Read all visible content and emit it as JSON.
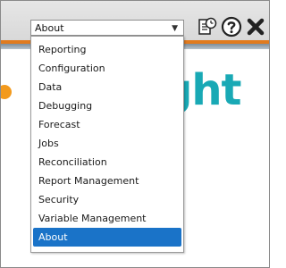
{
  "select": {
    "value": "About",
    "arrow_icon": "chevron-down-icon"
  },
  "toolbar": {
    "icons": [
      "report-schedule-icon",
      "help-icon",
      "close-icon"
    ]
  },
  "menu": {
    "options": [
      "Reporting",
      "Configuration",
      "Data",
      "Debugging",
      "Forecast",
      "Jobs",
      "Reconciliation",
      "Report Management",
      "Security",
      "Variable Management",
      "About"
    ],
    "selected_index": 10
  },
  "brand": {
    "logo_fragment": "ght"
  },
  "colors": {
    "accent_orange": "#e07b1f",
    "logo_teal": "#19a9b5",
    "selected_blue": "#1a73c8"
  }
}
